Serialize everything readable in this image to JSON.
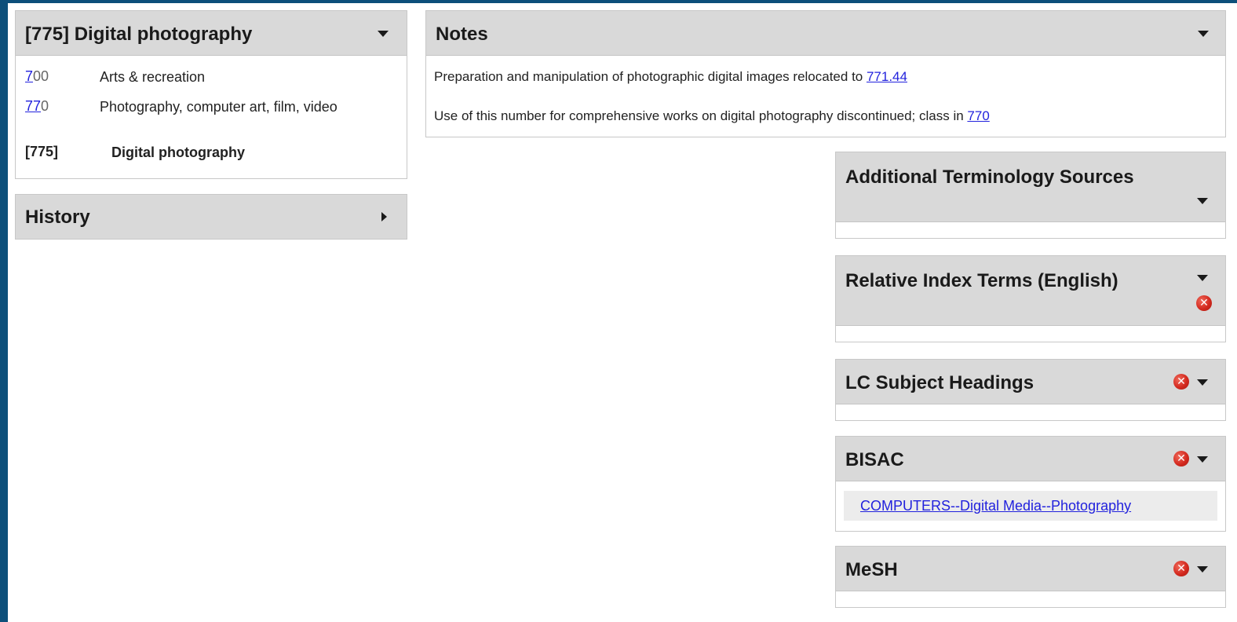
{
  "classification": {
    "title": "[775] Digital photography",
    "rows": [
      {
        "code_link": "7",
        "code_rest": "00",
        "label": "Arts & recreation"
      },
      {
        "code_link": "77",
        "code_rest": "0",
        "label": "Photography, computer art, film, video"
      },
      {
        "code_plain": "[775]",
        "label": "Digital photography"
      }
    ]
  },
  "history": {
    "title": "History"
  },
  "notes": {
    "title": "Notes",
    "lines": [
      {
        "text": "Preparation and manipulation of photographic digital images relocated to ",
        "link": "771.44"
      },
      {
        "text": "Use of this number for comprehensive works on digital photography discontinued; class in ",
        "link": "770"
      }
    ]
  },
  "right_panels": {
    "additional_terms": {
      "title": "Additional Terminology Sources"
    },
    "relative_index": {
      "title": "Relative Index Terms (English)"
    },
    "lcsh": {
      "title": "LC Subject Headings"
    },
    "bisac": {
      "title": "BISAC",
      "link": "COMPUTERS--Digital Media--Photography"
    },
    "mesh": {
      "title": "MeSH"
    }
  },
  "icons": {
    "expand": "caret-down-icon",
    "collapsed": "caret-right-icon",
    "remove": "remove-x-icon"
  },
  "colors": {
    "frame": "#0d4f7a",
    "header_bg": "#d9d9d9",
    "link": "#2222dd",
    "remove_icon": "#d42a1f"
  }
}
